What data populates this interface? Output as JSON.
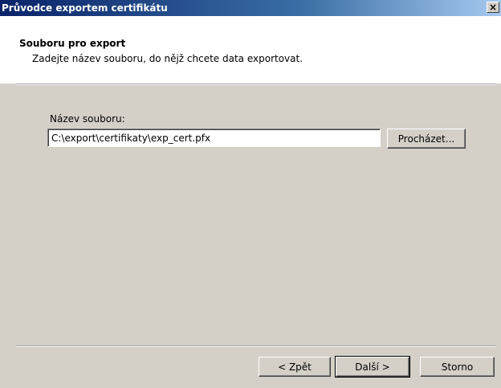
{
  "window": {
    "title": "Průvodce exportem certifikátu",
    "close_label": "×"
  },
  "header": {
    "title": "Souboru pro export",
    "subtitle": "Zadejte název souboru, do nějž chcete data exportovat."
  },
  "form": {
    "filename_label": "Název souboru:",
    "filename_value": "C:\\export\\certifikaty\\exp_cert.pfx",
    "browse_label": "Procházet..."
  },
  "footer": {
    "back_label": "< Zpět",
    "next_label": "Další >",
    "cancel_label": "Storno"
  }
}
